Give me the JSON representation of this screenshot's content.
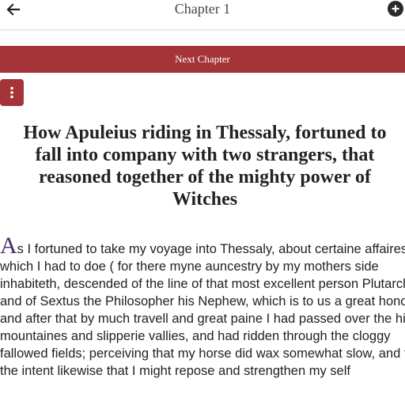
{
  "header": {
    "title": "Chapter 1",
    "back_icon": "arrow-left-icon",
    "add_icon": "plus-circle-icon"
  },
  "navigation": {
    "next_chapter_label": "Next Chapter"
  },
  "menu": {
    "icon": "vertical-dots-icon"
  },
  "chapter": {
    "heading": "How Apuleius riding in Thessaly, fortuned to fall into company with two strangers, that reasoned together of the mighty power of Witches",
    "drop_cap": "A",
    "body": "s I fortuned to take my voyage into Thessaly, about certaine affaires which I had to doe ( for there myne auncestry by my mothers side inhabiteth, descended of the line of that most excellent person Plutarch, and of Sextus the Philosopher his Nephew, which is to us a great honour) and after that by much travell and great paine I had passed over the high mountaines and slipperie vallies, and had ridden through the cloggy fallowed fields; perceiving that my horse did wax somewhat slow, and to the intent likewise that I might repose and strengthen my self"
  },
  "colors": {
    "accent": "#a43438",
    "drop_cap": "#4a2b6e"
  }
}
